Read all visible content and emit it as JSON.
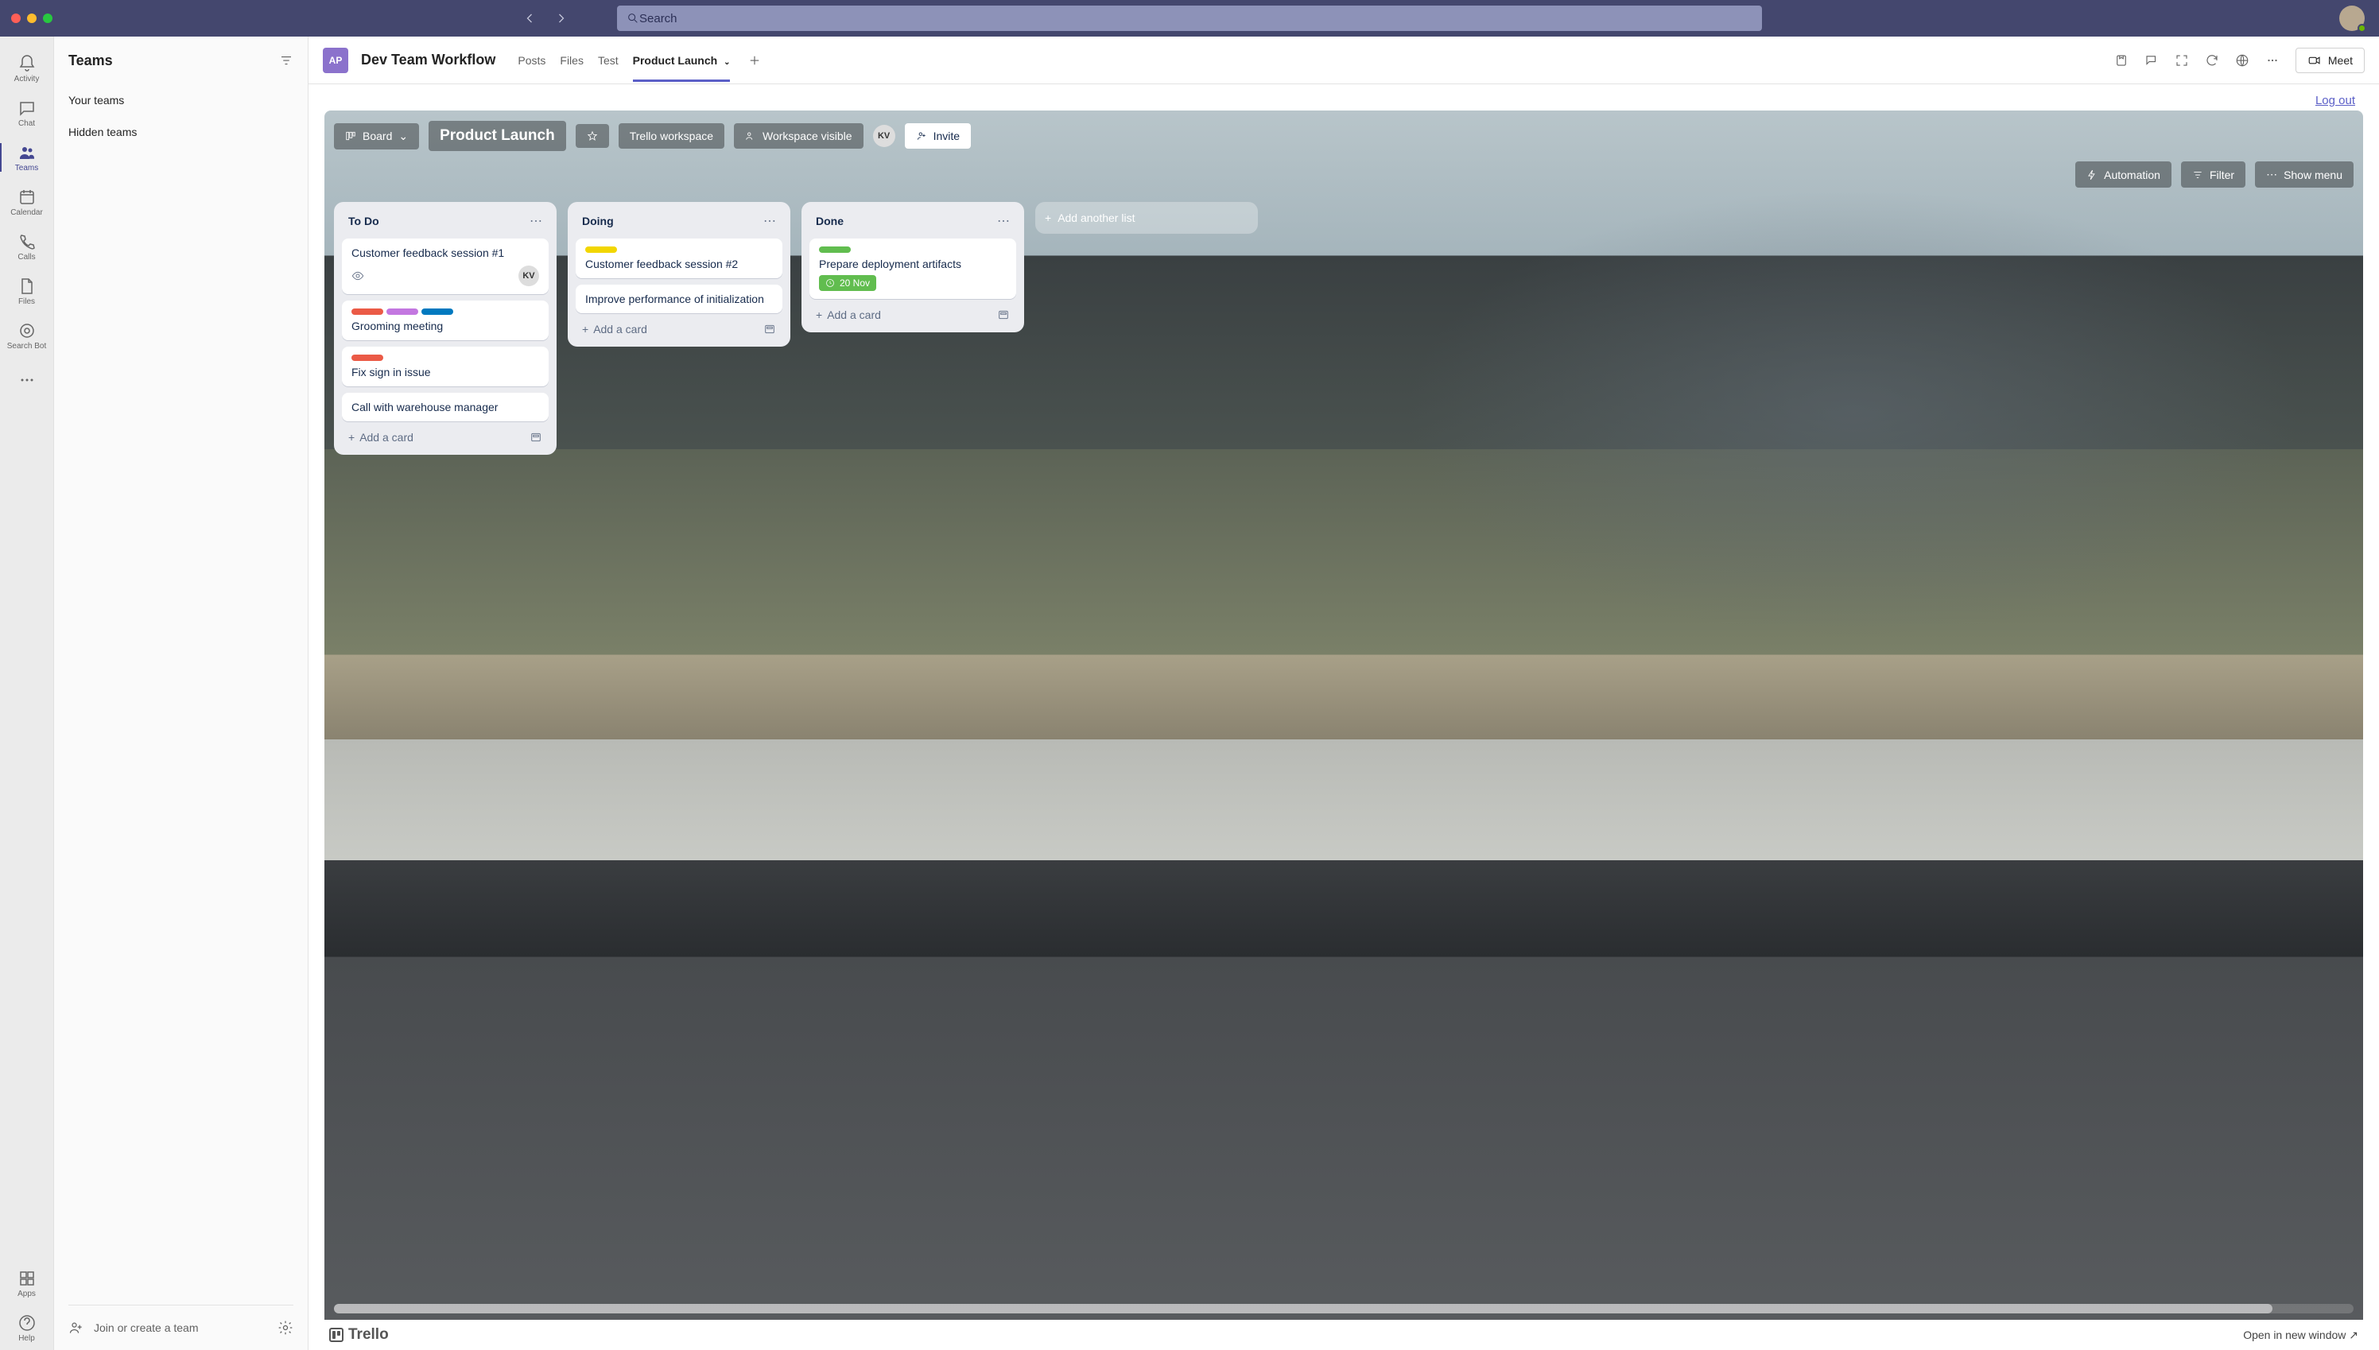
{
  "titlebar": {
    "search_placeholder": "Search"
  },
  "leftrail": [
    {
      "label": "Activity",
      "name": "rail-activity"
    },
    {
      "label": "Chat",
      "name": "rail-chat"
    },
    {
      "label": "Teams",
      "name": "rail-teams",
      "active": true
    },
    {
      "label": "Calendar",
      "name": "rail-calendar"
    },
    {
      "label": "Calls",
      "name": "rail-calls"
    },
    {
      "label": "Files",
      "name": "rail-files"
    },
    {
      "label": "Search Bot",
      "name": "rail-search-bot"
    }
  ],
  "leftrail_bottom": [
    {
      "label": "Apps",
      "name": "rail-apps"
    },
    {
      "label": "Help",
      "name": "rail-help"
    }
  ],
  "teams_panel": {
    "title": "Teams",
    "sections": [
      "Your teams",
      "Hidden teams"
    ],
    "join_label": "Join or create a team"
  },
  "channel": {
    "avatar_initials": "AP",
    "title": "Dev Team Workflow",
    "tabs": [
      {
        "label": "Posts",
        "active": false
      },
      {
        "label": "Files",
        "active": false
      },
      {
        "label": "Test",
        "active": false
      },
      {
        "label": "Product Launch",
        "active": true,
        "dropdown": true
      }
    ],
    "meet_label": "Meet",
    "logout_label": "Log out"
  },
  "trello": {
    "board_switcher": "Board",
    "board_name": "Product Launch",
    "workspace_label": "Trello workspace",
    "visibility_label": "Workspace visible",
    "members": [
      "KV"
    ],
    "invite_label": "Invite",
    "automation_label": "Automation",
    "filter_label": "Filter",
    "show_menu_label": "Show menu",
    "add_card_label": "Add a card",
    "add_list_label": "Add another list",
    "lists": [
      {
        "name": "To Do",
        "cards": [
          {
            "title": "Customer feedback session #1",
            "eye": true,
            "member": "KV"
          },
          {
            "title": "Grooming meeting",
            "labels": [
              "red",
              "purple",
              "blue"
            ]
          },
          {
            "title": "Fix sign in issue",
            "labels": [
              "red"
            ]
          },
          {
            "title": "Call with warehouse manager"
          }
        ]
      },
      {
        "name": "Doing",
        "cards": [
          {
            "title": "Customer feedback session #2",
            "labels": [
              "yellow"
            ]
          },
          {
            "title": "Improve performance of initialization"
          }
        ]
      },
      {
        "name": "Done",
        "cards": [
          {
            "title": "Prepare deployment artifacts",
            "labels": [
              "green"
            ],
            "due": "20 Nov"
          }
        ]
      }
    ],
    "footer_brand": "Trello",
    "open_new_window": "Open in new window"
  }
}
